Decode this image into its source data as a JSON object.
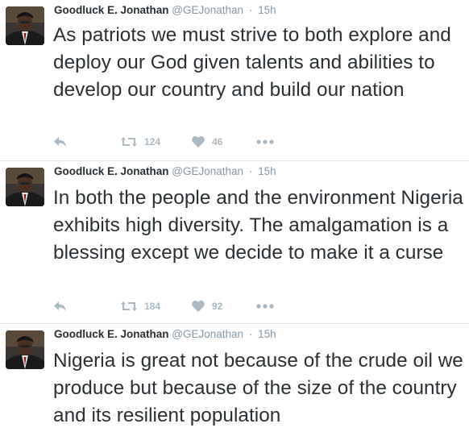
{
  "tweets": [
    {
      "name": "Goodluck E. Jonathan",
      "handle": "@GEJonathan",
      "separator": "·",
      "time": "15h",
      "text": "As patriots we must strive to both explore and deploy our God given talents and abilities to develop our country and build our nation",
      "retweets": "124",
      "likes": "46",
      "icons": [
        "reply-icon",
        "retweet-icon",
        "heart-icon",
        "more-icon"
      ]
    },
    {
      "name": "Goodluck E. Jonathan",
      "handle": "@GEJonathan",
      "separator": "·",
      "time": "15h",
      "text": "In both the people and the environment Nigeria exhibits high diversity. The amalgamation is a blessing except we decide to make it a curse",
      "retweets": "184",
      "likes": "92",
      "icons": [
        "reply-icon",
        "retweet-icon",
        "heart-icon",
        "more-icon"
      ]
    },
    {
      "name": "Goodluck E. Jonathan",
      "handle": "@GEJonathan",
      "separator": "·",
      "time": "15h",
      "text": "Nigeria is great not because of the crude oil we produce but because of the size of the country and its resilient population"
    }
  ],
  "colors": {
    "text": "#292f33",
    "meta": "#8899a6",
    "action": "#aab8c2",
    "divider": "#e1e8ed"
  }
}
